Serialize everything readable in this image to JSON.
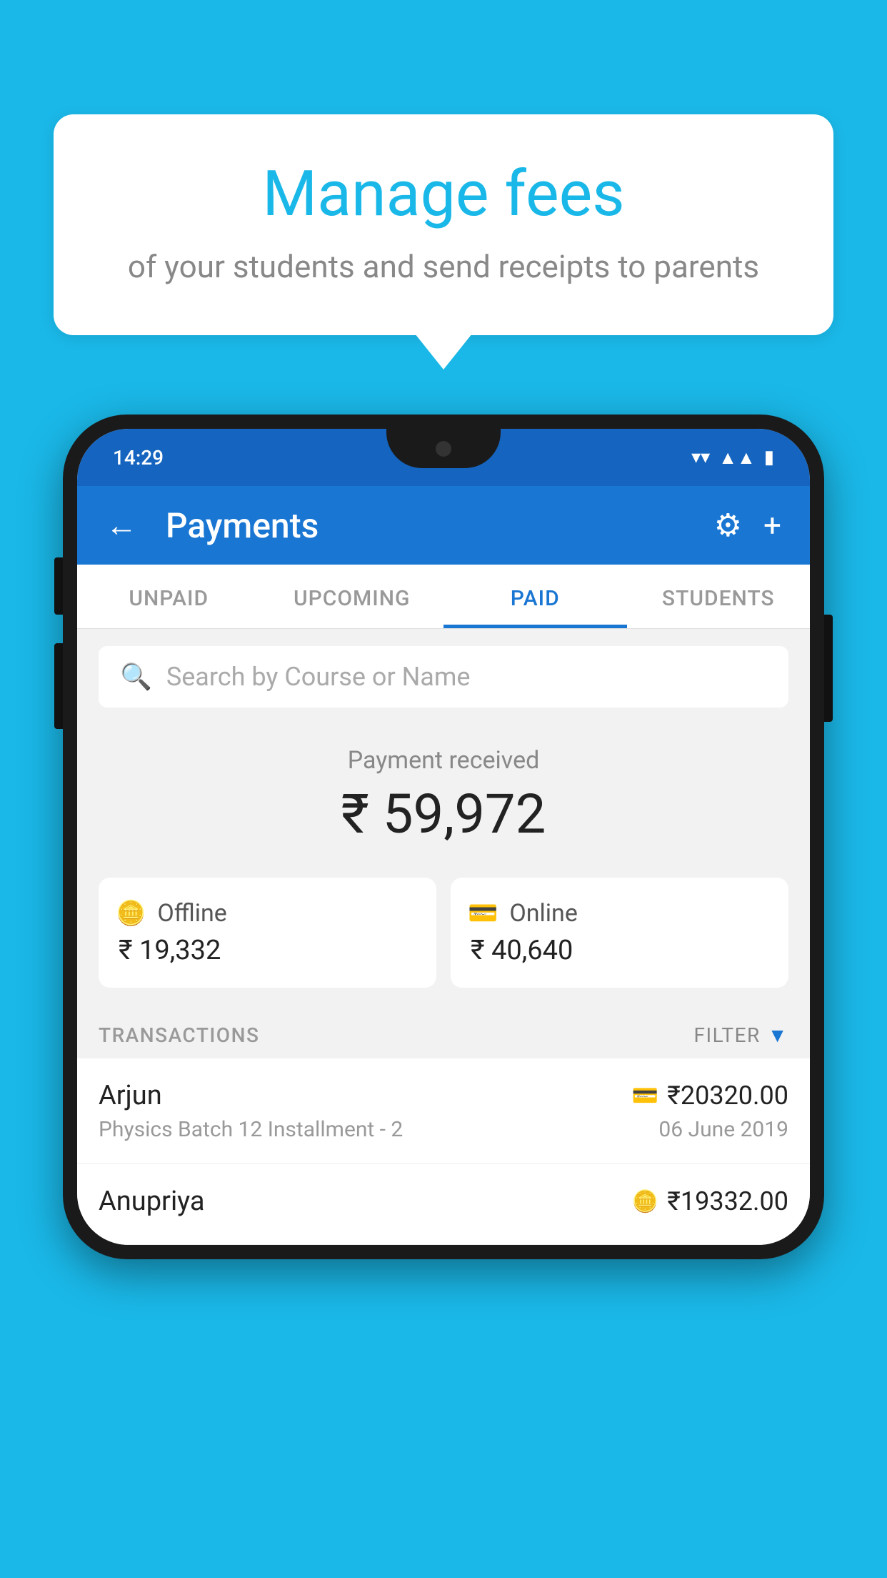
{
  "page": {
    "background_color": "#1ab8e8"
  },
  "speech_bubble": {
    "title": "Manage fees",
    "subtitle": "of your students and send receipts to parents"
  },
  "status_bar": {
    "time": "14:29"
  },
  "app_bar": {
    "title": "Payments",
    "back_label": "←",
    "settings_label": "⚙",
    "add_label": "+"
  },
  "tabs": [
    {
      "label": "UNPAID",
      "active": false
    },
    {
      "label": "UPCOMING",
      "active": false
    },
    {
      "label": "PAID",
      "active": true
    },
    {
      "label": "STUDENTS",
      "active": false
    }
  ],
  "search": {
    "placeholder": "Search by Course or Name"
  },
  "payment_summary": {
    "label": "Payment received",
    "amount": "₹ 59,972",
    "offline": {
      "label": "Offline",
      "amount": "₹ 19,332"
    },
    "online": {
      "label": "Online",
      "amount": "₹ 40,640"
    }
  },
  "transactions": {
    "header": "TRANSACTIONS",
    "filter_label": "FILTER",
    "rows": [
      {
        "name": "Arjun",
        "description": "Physics Batch 12 Installment - 2",
        "amount": "₹20320.00",
        "date": "06 June 2019",
        "type": "online"
      },
      {
        "name": "Anupriya",
        "description": "",
        "amount": "₹19332.00",
        "date": "",
        "type": "offline"
      }
    ]
  }
}
